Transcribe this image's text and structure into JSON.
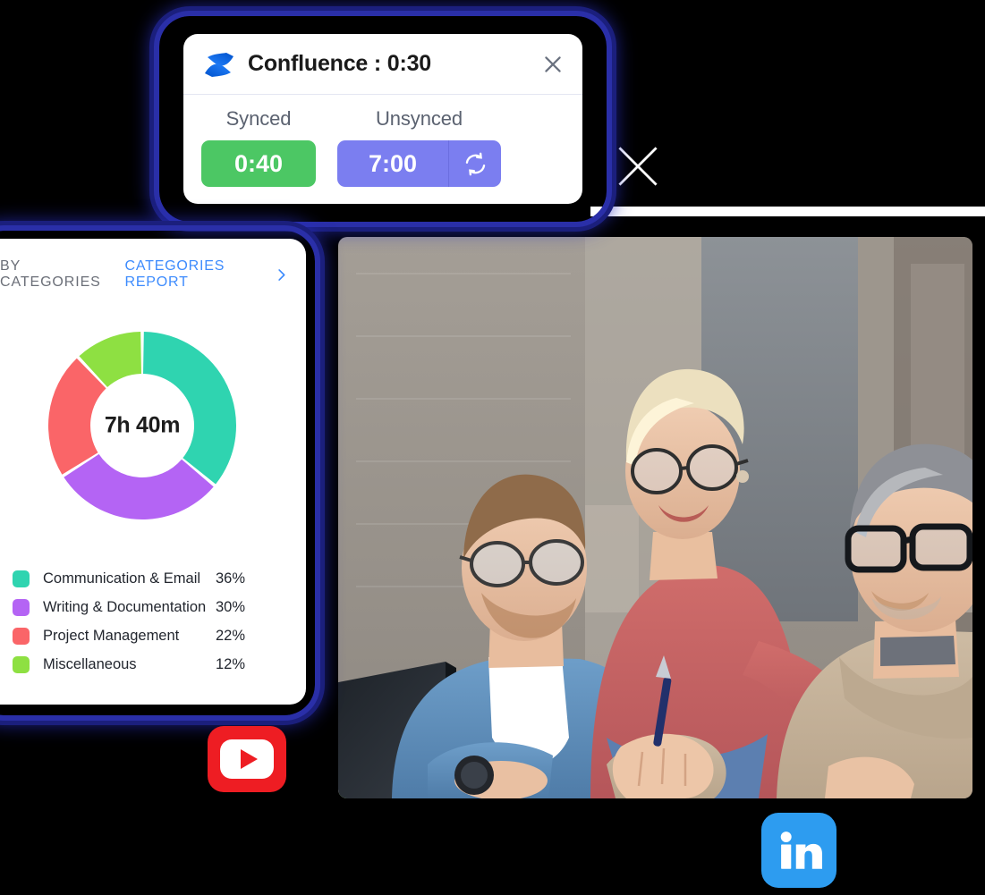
{
  "popup": {
    "app_icon": "confluence-logo-icon",
    "title": "Confluence : 0:30",
    "close_icon": "close-icon",
    "synced_label": "Synced",
    "unsynced_label": "Unsynced",
    "synced_value": "0:40",
    "unsynced_value": "7:00",
    "sync_icon": "refresh-sync-icon",
    "synced_color": "#4cc764",
    "unsynced_color": "#7b7ef0"
  },
  "dashboard": {
    "section_title": "BY CATEGORIES",
    "report_link": "CATEGORIES REPORT",
    "chevron_icon": "chevron-right-icon",
    "total_time": "7h 40m",
    "link_color": "#3d8bfd"
  },
  "chart_data": {
    "type": "pie",
    "title": "BY CATEGORIES",
    "center_label": "7h 40m",
    "categories": [
      "Communication & Email",
      "Writing & Documentation",
      "Project Management",
      "Miscellaneous"
    ],
    "values": [
      36,
      30,
      22,
      12
    ],
    "value_labels": [
      "36%",
      "30%",
      "22%",
      "12%"
    ],
    "colors": [
      "#2fd4b0",
      "#b464f4",
      "#fa6568",
      "#8ee042"
    ],
    "units": "percent",
    "legend_position": "bottom",
    "donut": true,
    "start_angle": 0
  },
  "photo": {
    "alt": "three colleagues looking at a computer monitor in an office"
  },
  "social": {
    "x_icon": "x-twitter-logo-icon",
    "youtube_icon": "youtube-logo-icon",
    "linkedin_icon": "linkedin-logo-icon",
    "youtube_color": "#ee1d23",
    "linkedin_color": "#2d9cf0"
  }
}
